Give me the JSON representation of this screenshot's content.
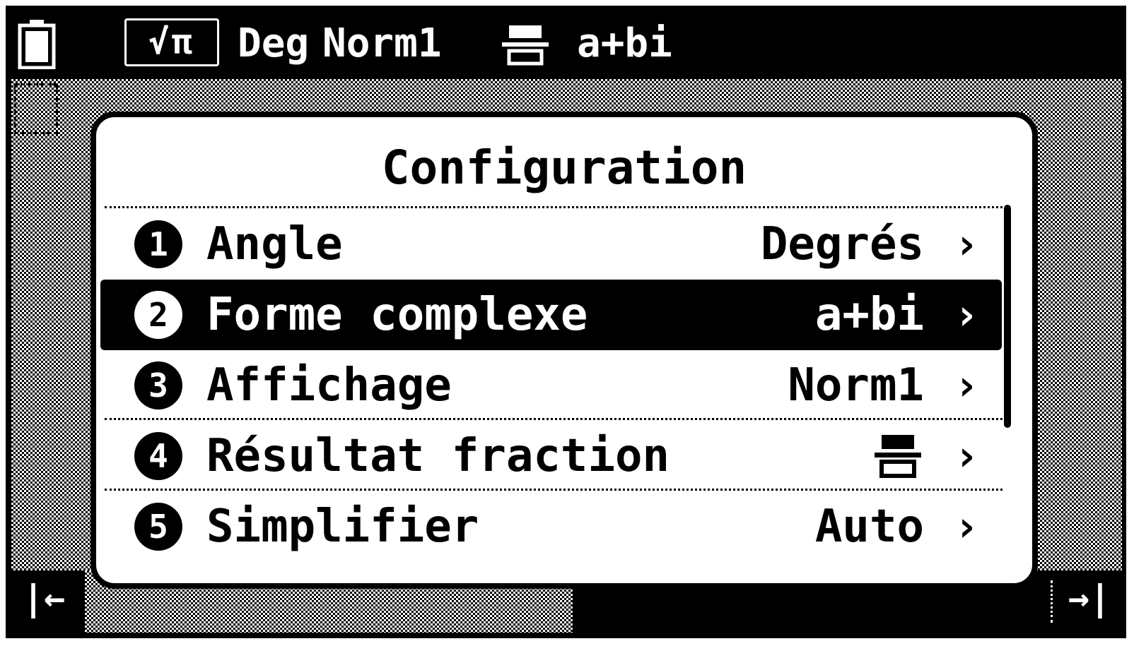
{
  "status": {
    "mode": "√π",
    "angle": "Deg",
    "display": "Norm1",
    "complex": "a+bi"
  },
  "dialog": {
    "title": "Configuration",
    "items": [
      {
        "num": "1",
        "label": "Angle",
        "value": "Degrés",
        "selected": false
      },
      {
        "num": "2",
        "label": "Forme complexe",
        "value": "a+bi",
        "selected": true
      },
      {
        "num": "3",
        "label": "Affichage",
        "value": "Norm1",
        "selected": false
      },
      {
        "num": "4",
        "label": "Résultat fraction",
        "value": "",
        "value_icon": "fraction-icon",
        "selected": false
      },
      {
        "num": "5",
        "label": "Simplifier",
        "value": "Auto",
        "selected": false
      }
    ]
  },
  "bottombar": {
    "left_arrow": "|←",
    "right_arrow": "→|"
  },
  "icons": {
    "battery": "battery-icon",
    "fraction": "fraction-icon",
    "chevron": "›"
  },
  "colors": {
    "foreground": "#000000",
    "background": "#ffffff"
  }
}
